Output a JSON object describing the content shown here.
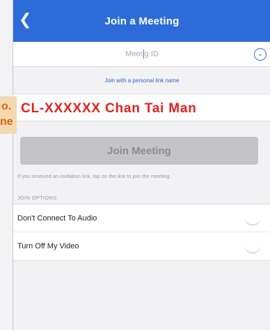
{
  "header": {
    "title": "Join a Meeting",
    "back_icon": "chevron-left-icon"
  },
  "meeting_id": {
    "placeholder_left": "Meet",
    "placeholder_right": "g ID",
    "dropdown_icon": "chevron-down-circle-icon"
  },
  "personal_link": "Join with a personal link name",
  "overlay": {
    "left_line1": "o.",
    "left_line2": "ne",
    "name_text": "CL-XXXXXX Chan Tai Man"
  },
  "join_button": "Join Meeting",
  "hint": "If you received an invitation link, tap on the link to join the meeting.",
  "join_options": {
    "label": "JOIN OPTIONS",
    "items": [
      {
        "label": "Don't Connect To Audio"
      },
      {
        "label": "Turn Off My Video"
      }
    ]
  },
  "colors": {
    "header_bg": "#2d6cd8",
    "overlay_red": "#e2201b",
    "overlay_orange": "#d46610",
    "button_disabled": "#c4c4c8"
  }
}
